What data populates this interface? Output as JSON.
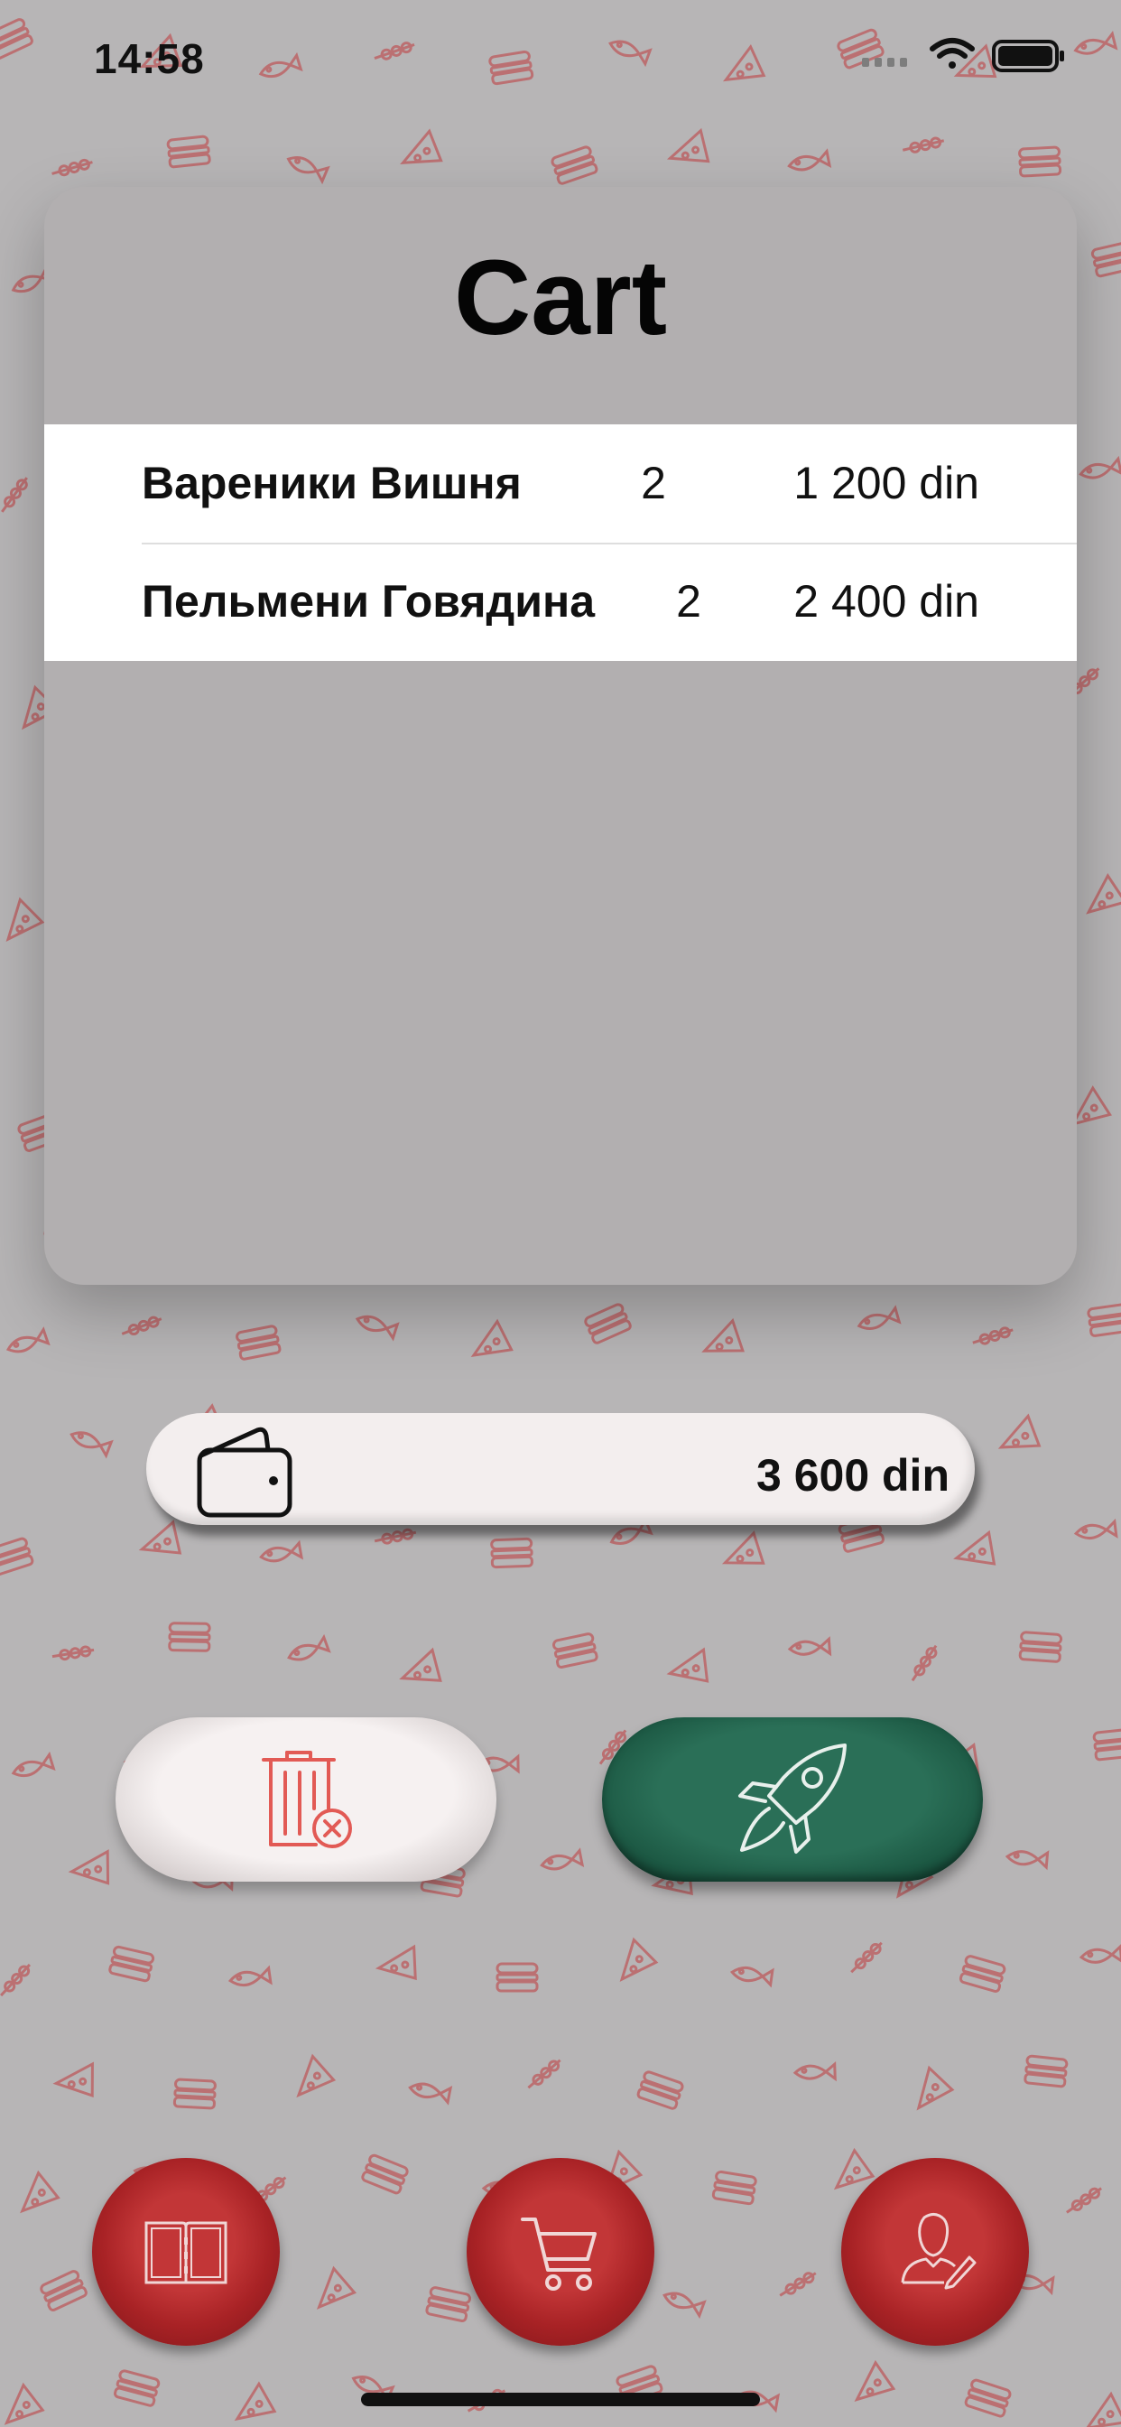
{
  "status_bar": {
    "time": "14:58"
  },
  "cart": {
    "title": "Cart",
    "items": [
      {
        "name": "Вареники Вишня",
        "quantity": "2",
        "price": "1 200 din"
      },
      {
        "name": "Пельмени Говядина",
        "quantity": "2",
        "price": "2 400 din"
      }
    ]
  },
  "total": {
    "amount": "3 600 din",
    "icon": "wallet-icon"
  },
  "actions": {
    "clear_icon": "trash-x-icon",
    "order_icon": "rocket-icon"
  },
  "tab_bar": {
    "items": [
      {
        "icon": "book-icon"
      },
      {
        "icon": "cart-icon"
      },
      {
        "icon": "profile-icon"
      }
    ]
  },
  "colors": {
    "background": "#b7b5b6",
    "pattern": "#c0393b",
    "accent_green": "#1c5843",
    "accent_red": "#a82225"
  }
}
